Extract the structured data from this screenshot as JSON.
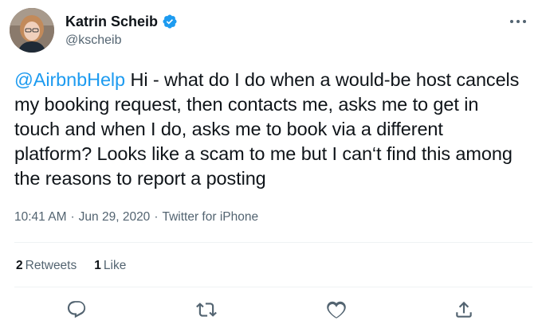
{
  "tweet": {
    "author": {
      "name": "Katrin Scheib",
      "handle": "@kscheib",
      "verified": true
    },
    "text": {
      "mention": "@AirbnbHelp",
      "body": " Hi - what do I do when a would-be host cancels my booking request, then contacts me, asks me to get in touch and when I do, asks me to book via a different platform? Looks like a scam to me but I can‘t find this among the reasons to report a posting"
    },
    "meta": {
      "time": "10:41 AM",
      "separator": "·",
      "date": "Jun 29, 2020",
      "source": "Twitter for iPhone"
    },
    "stats": {
      "retweets_count": "2",
      "retweets_label": "Retweets",
      "likes_count": "1",
      "likes_label": "Like"
    }
  },
  "icons": {
    "more": "more-options-icon",
    "reply": "reply-icon",
    "retweet": "retweet-icon",
    "like": "heart-icon",
    "share": "share-icon",
    "verified": "verified-badge-icon"
  },
  "colors": {
    "accent": "#1d9bf0",
    "text": "#0f1419",
    "secondary": "#536471"
  }
}
